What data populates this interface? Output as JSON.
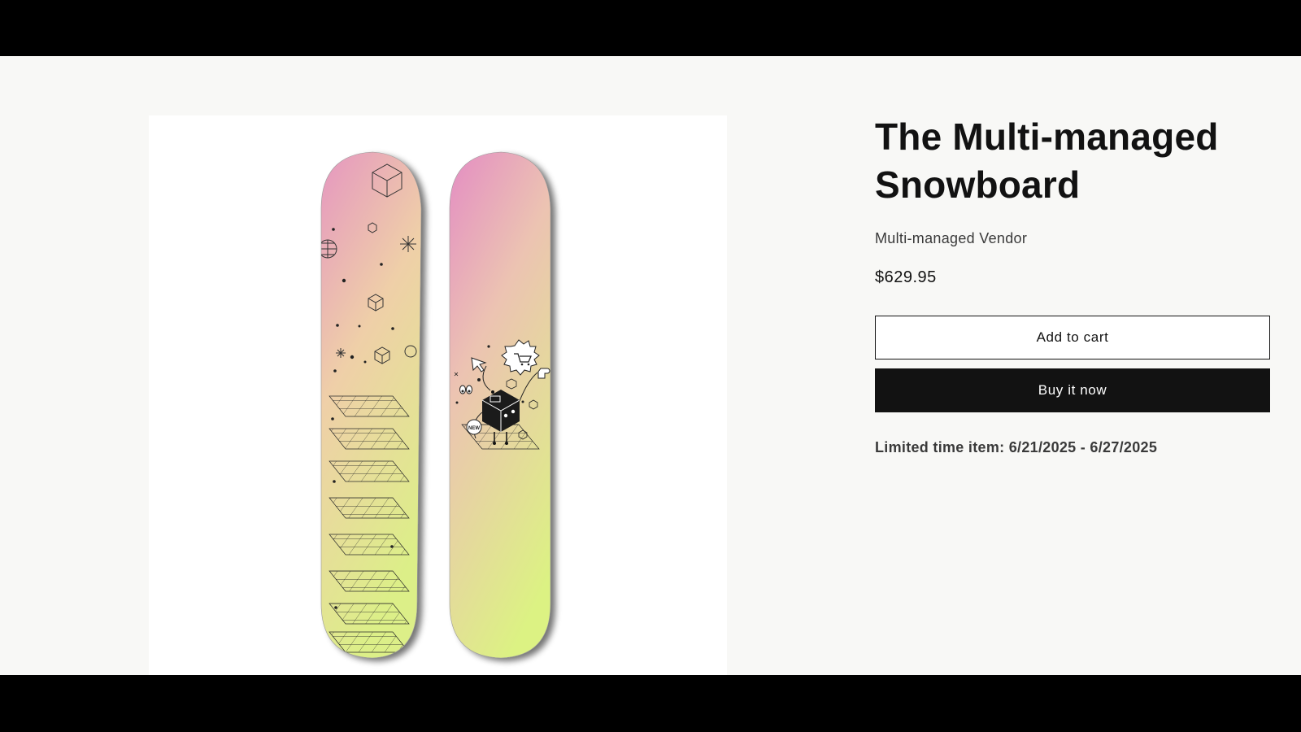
{
  "product": {
    "title_line1": "The Multi-managed",
    "title_line2": "Snowboard",
    "vendor": "Multi-managed Vendor",
    "price": "$629.95",
    "add_to_cart_label": "Add to cart",
    "buy_now_label": "Buy it now",
    "limited_text": "Limited time item: 6/21/2025 - 6/27/2025",
    "image": {
      "subject": "snowboard-pair",
      "gradient_colors": [
        "#e596c0",
        "#efcfa8",
        "#dcef88"
      ],
      "graphic_badge": "NEW"
    }
  },
  "colors": {
    "page_background": "#f8f8f6",
    "text": "#121212",
    "secondary_text": "#3a3a3a",
    "buy_button": "#121212"
  }
}
